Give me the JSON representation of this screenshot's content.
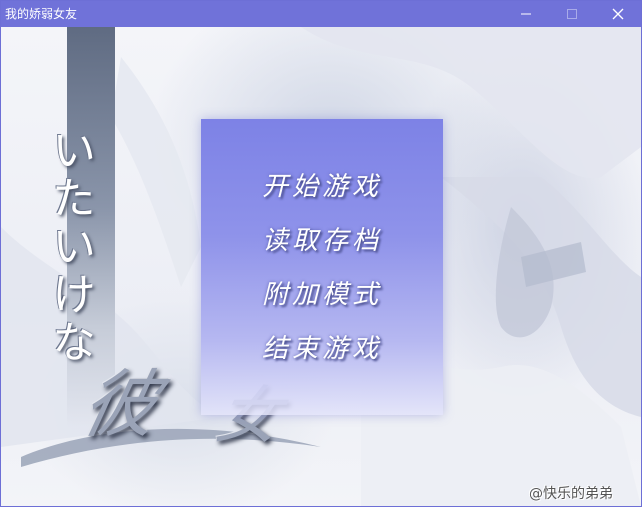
{
  "window": {
    "title": "我的娇弱女友"
  },
  "titlebar_buttons": {
    "minimize_icon": "minimize-icon",
    "maximize_icon": "maximize-icon",
    "close_icon": "close-icon"
  },
  "logo": {
    "kana": "いたいけな",
    "kanji_1": "彼",
    "kanji_2": "女"
  },
  "menu": {
    "items": [
      {
        "label": "开始游戏"
      },
      {
        "label": "读取存档"
      },
      {
        "label": "附加模式"
      },
      {
        "label": "结束游戏"
      }
    ]
  },
  "watermark": "@快乐的弟弟",
  "colors": {
    "titlebar": "#7072d9",
    "menu_panel_top": "#7d82e6",
    "menu_panel_bottom": "#e2e3fa"
  }
}
